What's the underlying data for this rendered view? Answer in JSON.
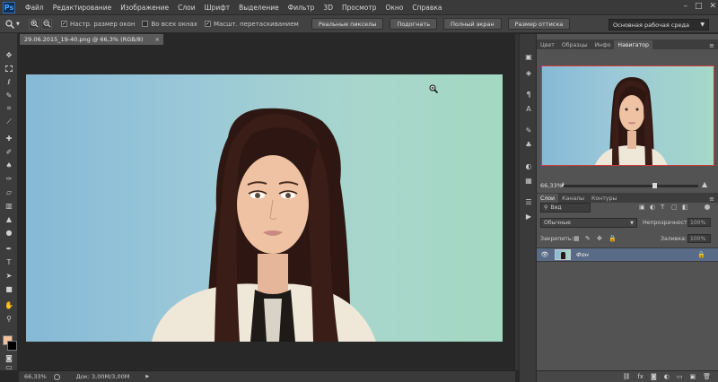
{
  "app": {
    "logo": "Ps",
    "menu": [
      "Файл",
      "Редактирование",
      "Изображение",
      "Слои",
      "Шрифт",
      "Выделение",
      "Фильтр",
      "3D",
      "Просмотр",
      "Окно",
      "Справка"
    ],
    "window_controls": [
      "–",
      "□",
      "✕"
    ]
  },
  "options_bar": {
    "tool_icon": "zoom-icon",
    "checks": [
      {
        "label": "Настр. размер окон",
        "checked": true
      },
      {
        "label": "Во всех окнах",
        "checked": false
      },
      {
        "label": "Масшт. перетаскиванием",
        "checked": true
      }
    ],
    "buttons": [
      "Реальные пикселы",
      "Подогнать",
      "Полный экран",
      "Размер оттиска"
    ],
    "workspace": "Основная рабочая среда"
  },
  "document": {
    "tab_title": "29.06.2015_19-40.png @ 66,3% (RGB/8)",
    "tab_close": "×"
  },
  "status": {
    "zoom": "66,33%",
    "doc_info": "Док: 3,00M/3,00M"
  },
  "navigator": {
    "tabs": [
      "Цвет",
      "Образцы",
      "Инфо",
      "Навигатор"
    ],
    "active_tab": "Навигатор",
    "zoom": "66,33%",
    "zoom_fraction": 0.68
  },
  "layers": {
    "tabs": [
      "Слои",
      "Каналы",
      "Контуры"
    ],
    "active_tab": "Слои",
    "filter_label": "Вид",
    "blend_mode": "Обычные",
    "opacity_label": "Непрозрачность:",
    "opacity_value": "100%",
    "lock_label": "Закрепить:",
    "fill_label": "Заливка:",
    "fill_value": "100%",
    "items": [
      {
        "name": "Фон",
        "visible": true,
        "locked": true
      }
    ]
  },
  "colors": {
    "foreground": "#f5c29e",
    "background": "#000000"
  }
}
